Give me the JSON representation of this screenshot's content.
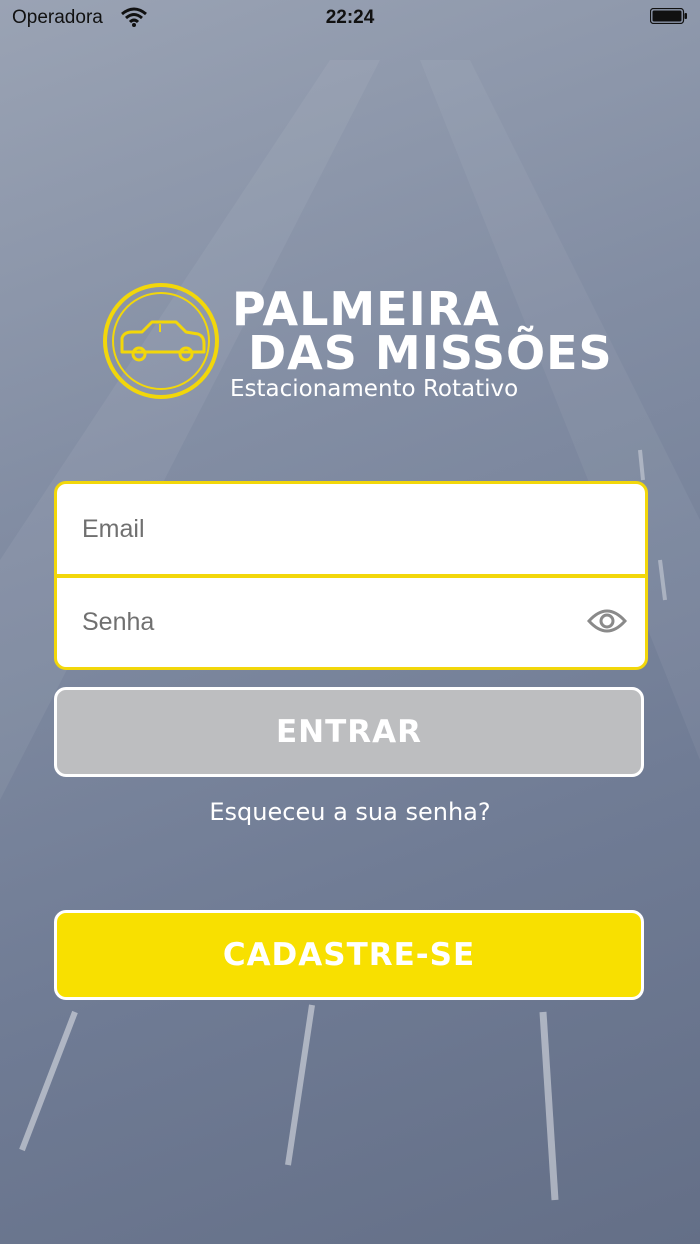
{
  "status_bar": {
    "carrier": "Operadora",
    "time": "22:24",
    "wifi_icon": "wifi-icon",
    "battery_icon": "battery-icon"
  },
  "logo": {
    "icon": "car-circle-icon",
    "title_line1": "PALMEIRA",
    "title_line2": "DAS MISSÕES",
    "subtitle": "Estacionamento Rotativo"
  },
  "form": {
    "email_placeholder": "Email",
    "password_placeholder": "Senha",
    "password_toggle_icon": "eye-icon"
  },
  "buttons": {
    "login_label": "ENTRAR",
    "forgot_label": "Esqueceu a sua senha?",
    "register_label": "CADASTRE-SE"
  },
  "colors": {
    "accent_yellow": "#f8e000",
    "border_yellow": "#f2d70a",
    "disabled_gray": "#bdbec0",
    "background": "#6e7b93"
  }
}
